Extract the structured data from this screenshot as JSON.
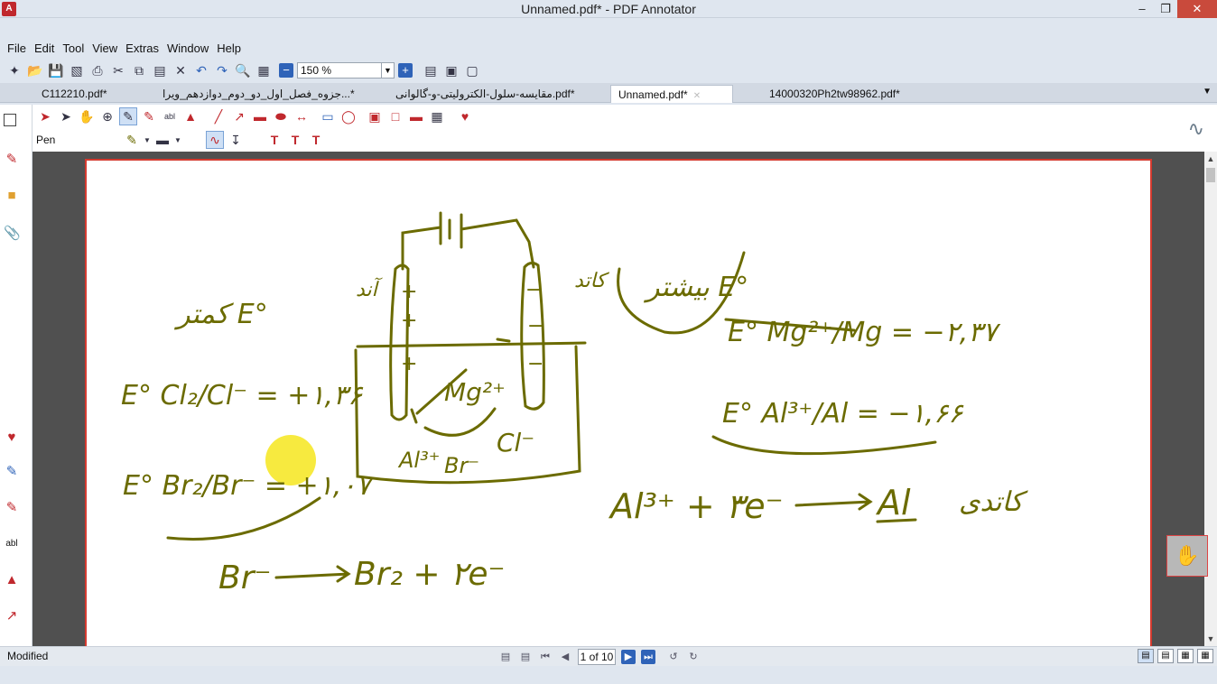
{
  "window": {
    "title": "Unnamed.pdf* - PDF Annotator",
    "app_icon": "pdf-annotator-icon"
  },
  "menu": [
    "File",
    "Edit",
    "Tool",
    "View",
    "Extras",
    "Window",
    "Help"
  ],
  "zoom": {
    "value": "150 %"
  },
  "tabs": [
    {
      "label": "C112210.pdf*",
      "active": false
    },
    {
      "label": "جزوه_فصل_اول_دو_دوم_دوازدهم_ویرا...*",
      "active": false
    },
    {
      "label": "مقایسه-سلول-الکترولیتی-و-گالوانی.pdf*",
      "active": false
    },
    {
      "label": "Unnamed.pdf*",
      "active": true
    },
    {
      "label": "14000320Ph2tw98962.pdf*",
      "active": false
    }
  ],
  "tool": {
    "current_label": "Pen"
  },
  "annotation": {
    "ink_color": "#6b6b00",
    "labels": {
      "less_e": "کمتر E°",
      "anode": "آند",
      "cathode": "کاتد",
      "more_e": "بیشتر E°",
      "cathode_word": "کاتدی",
      "e_cl": "E° Cl₂/Cl⁻ = +۱,۳۶",
      "e_br": "E° Br₂/Br⁻ = +۱,۰۷",
      "e_mg": "E° Mg²⁺/Mg = −۲,۳۷",
      "e_al": "E° Al³⁺/Al = −۱,۶۶",
      "ion_mg": "Mg²⁺",
      "ion_al": "Al³⁺",
      "ion_br": "Br⁻",
      "ion_cl": "Cl⁻",
      "eq_al_lhs": "Al³⁺ + ۳e⁻",
      "eq_al_rhs": "Al",
      "eq_br_lhs": "Br⁻",
      "eq_br_rhs": "Br₂ + ۲e⁻"
    }
  },
  "status": {
    "text": "Modified",
    "page_indicator": "1 of 10"
  }
}
